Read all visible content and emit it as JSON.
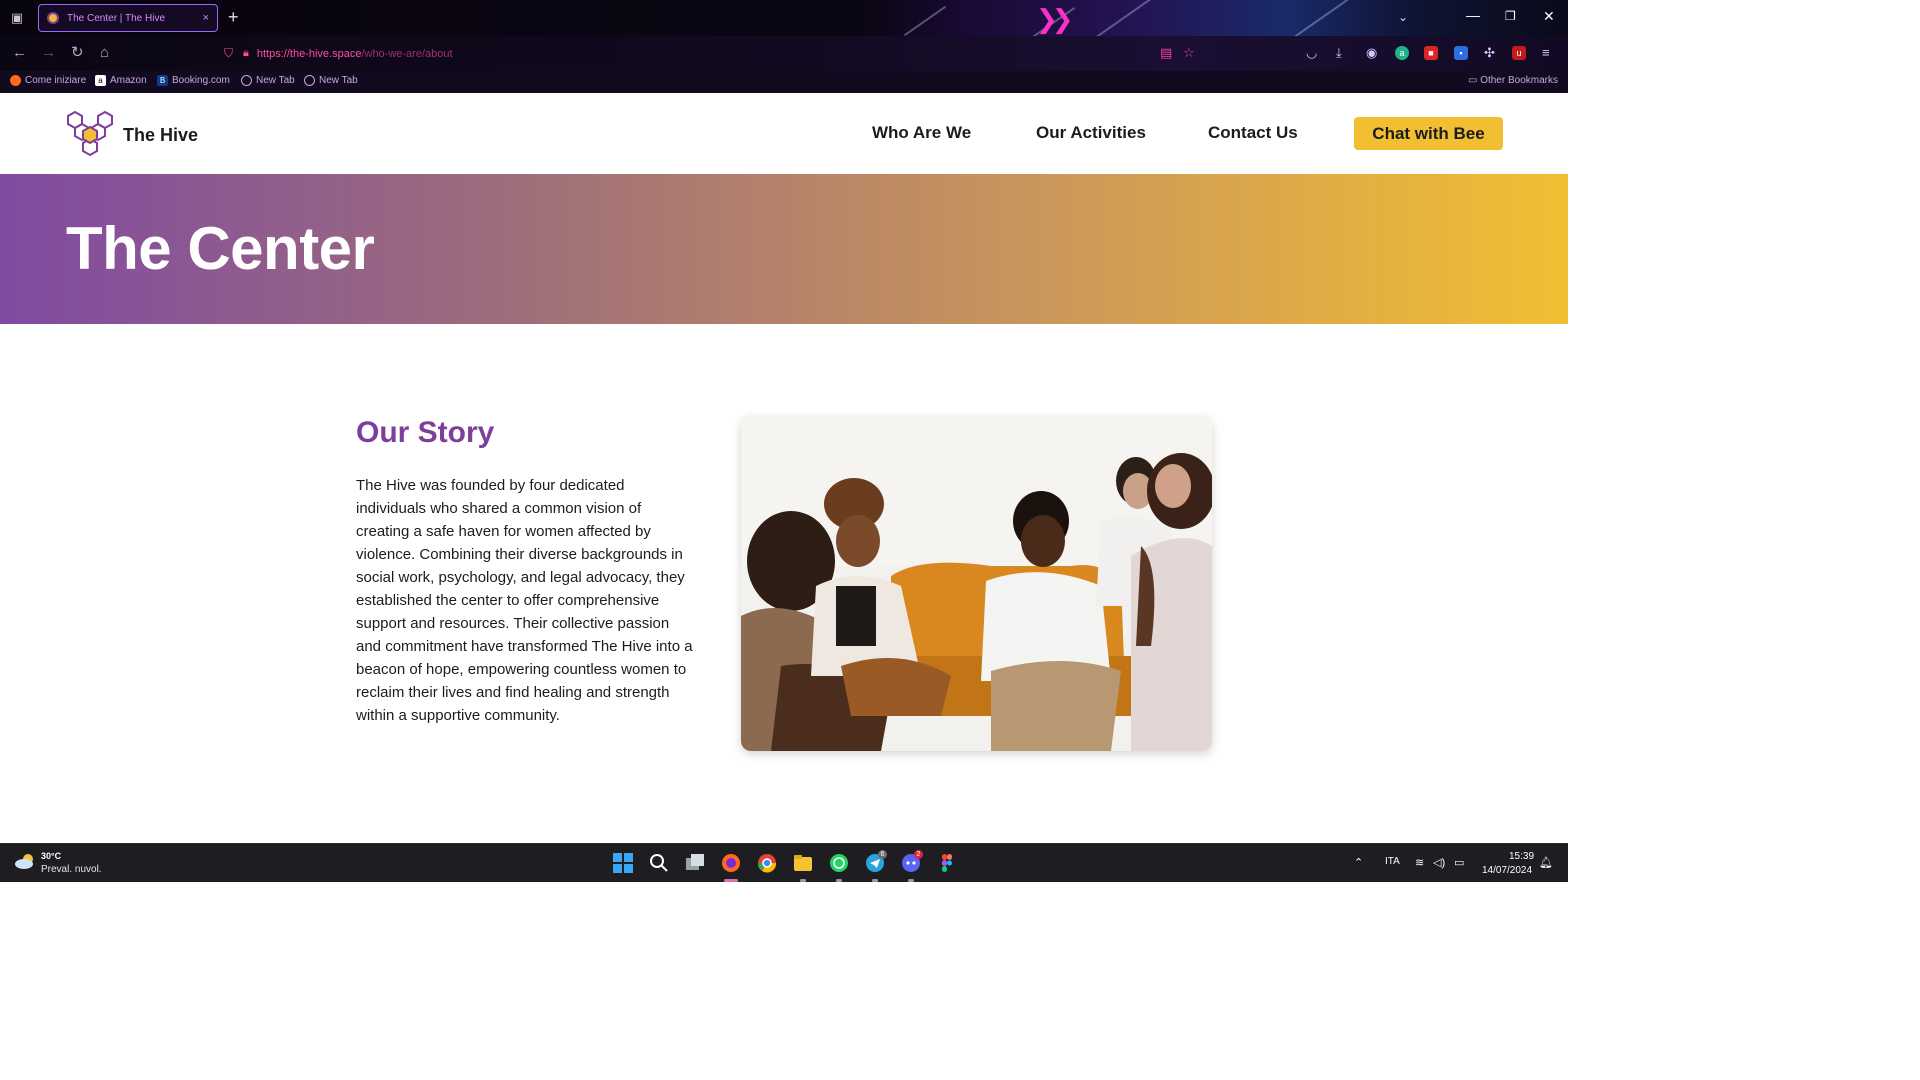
{
  "browser": {
    "tab_title": "The Center | The Hive",
    "tab_close": "×",
    "new_tab": "+",
    "url_domain": "https://the-hive.space",
    "url_path": "/who-we-are/about",
    "bookmarks": [
      "Come iniziare",
      "Amazon",
      "Booking.com",
      "New Tab",
      "New Tab"
    ],
    "other_bookmarks": "Other Bookmarks",
    "window_controls": {
      "minimize": "—",
      "maximize": "❐",
      "close": "✕"
    }
  },
  "site": {
    "brand": "The Hive",
    "nav": [
      "Who Are We",
      "Our Activities",
      "Contact Us"
    ],
    "cta": "Chat with Bee",
    "hero_title": "The Center",
    "story": {
      "title": "Our Story",
      "body": "The Hive was founded by four dedicated individuals who shared a common vision of creating a safe haven for women affected by violence. Combining their diverse backgrounds in social work, psychology, and legal advocacy, they established the center to offer comprehensive support and resources. Their collective passion and commitment have transformed The Hive into a beacon of hope, empowering countless women to reclaim their lives and find healing and strength within a supportive community."
    },
    "colors": {
      "purple": "#7d3f9b",
      "yellow": "#f2bf32",
      "hero_start": "#804aa1"
    }
  },
  "taskbar": {
    "weather_temp": "30°C",
    "weather_desc": "Preval. nuvol.",
    "language": "ITA",
    "time": "15:39",
    "date": "14/07/2024",
    "telegram_badge": "6",
    "discord_badge": "2"
  }
}
